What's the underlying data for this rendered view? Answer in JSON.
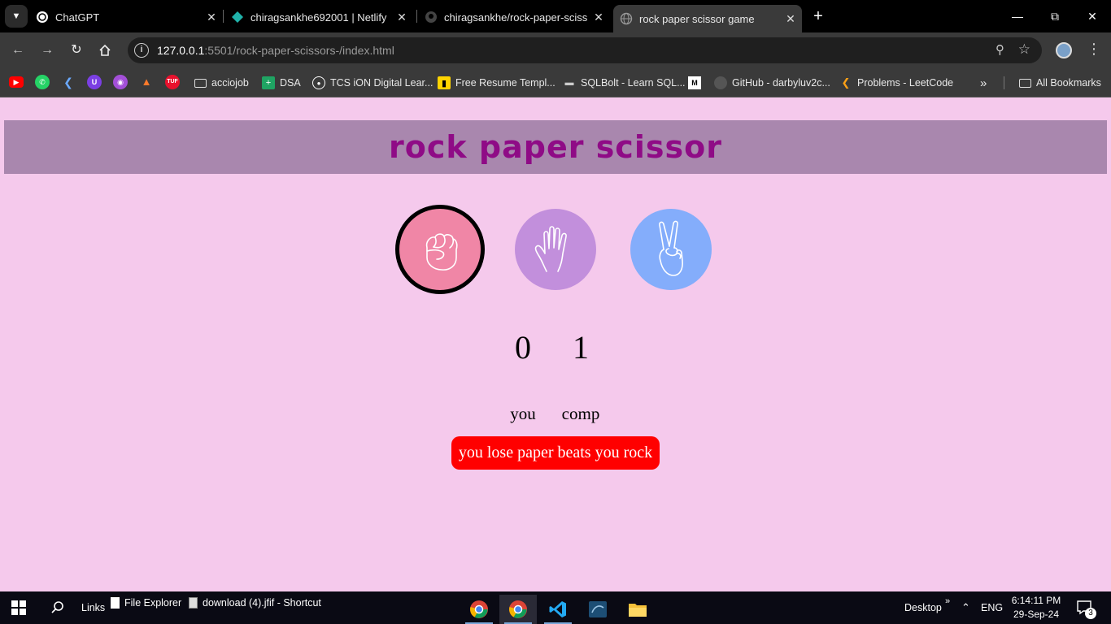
{
  "browser": {
    "tabs": [
      {
        "title": "ChatGPT",
        "icon": "chatgpt-icon",
        "active": false
      },
      {
        "title": "chiragsankhe692001 | Netlify",
        "icon": "netlify-icon",
        "active": false
      },
      {
        "title": "chiragsankhe/rock-paper-scisso",
        "icon": "github-icon",
        "active": false
      },
      {
        "title": "rock paper scissor game",
        "icon": "globe-icon",
        "active": true
      }
    ],
    "url_host": "127.0.0.1",
    "url_rest": ":5501/rock-paper-scissors-/index.html",
    "bookmarks": [
      {
        "label": "acciojob",
        "icon": "folder-icon"
      },
      {
        "label": "DSA",
        "icon": "sheets-icon"
      },
      {
        "label": "TCS iON Digital Lear...",
        "icon": "tcs-icon"
      },
      {
        "label": "Free Resume Templ...",
        "icon": "resume-icon"
      },
      {
        "label": "SQLBolt - Learn SQL...",
        "icon": "database-icon"
      },
      {
        "label": "",
        "icon": "medium-icon"
      },
      {
        "label": "GitHub - darbyluv2c...",
        "icon": "github-icon"
      },
      {
        "label": "Problems - LeetCode",
        "icon": "leetcode-icon"
      }
    ],
    "all_bookmarks": "All Bookmarks"
  },
  "game": {
    "title": "rock paper scissor",
    "choices": [
      {
        "name": "rock",
        "color": "#f086a6",
        "selected": true
      },
      {
        "name": "paper",
        "color": "#c28fdc",
        "selected": false
      },
      {
        "name": "scissor",
        "color": "#84adfb",
        "selected": false
      }
    ],
    "user_score": "0",
    "comp_score": "1",
    "user_label": "you",
    "comp_label": "comp",
    "message": "you lose paper beats you rock",
    "message_color": "#ff0000",
    "banner_color": "#a987ae",
    "title_color": "#8f0b86",
    "background": "#f5c9ec"
  },
  "taskbar": {
    "links": "Links",
    "file_explorer": "File Explorer",
    "shortcut": "download (4).jfif - Shortcut",
    "desktop": "Desktop",
    "lang": "ENG",
    "time": "6:14:11 PM",
    "date": "29-Sep-24",
    "notifications": "3"
  }
}
